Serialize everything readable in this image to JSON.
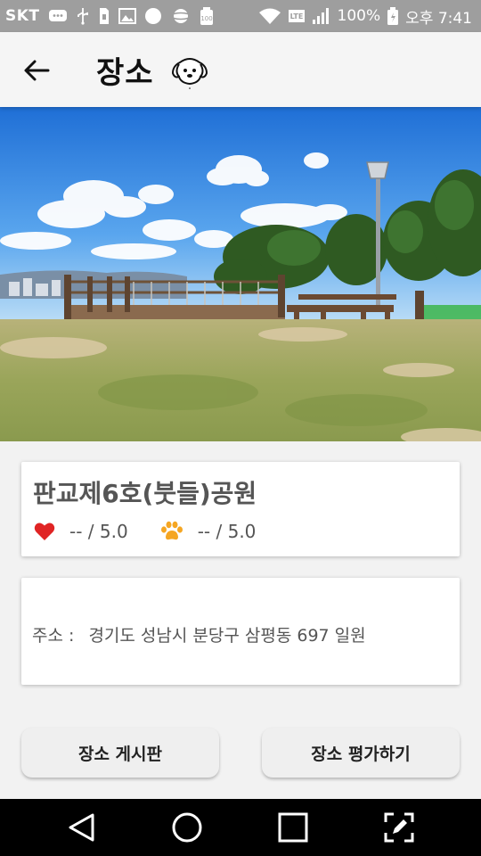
{
  "status_bar": {
    "carrier": "SKT",
    "battery": "100%",
    "time": "오후 7:41"
  },
  "app_bar": {
    "title": "장소"
  },
  "place": {
    "name": "판교제6호(붓들)공원",
    "heart_rating": "--  / 5.0",
    "paw_rating": "--  / 5.0",
    "address_label": "주소 :",
    "address": "경기도 성남시 분당구 삼평동 697 일원"
  },
  "actions": {
    "board_label": "장소 게시판",
    "rate_label": "장소 평가하기"
  },
  "colors": {
    "heart": "#e02424",
    "paw": "#f5a623",
    "status_bar": "#9e9e9e"
  }
}
